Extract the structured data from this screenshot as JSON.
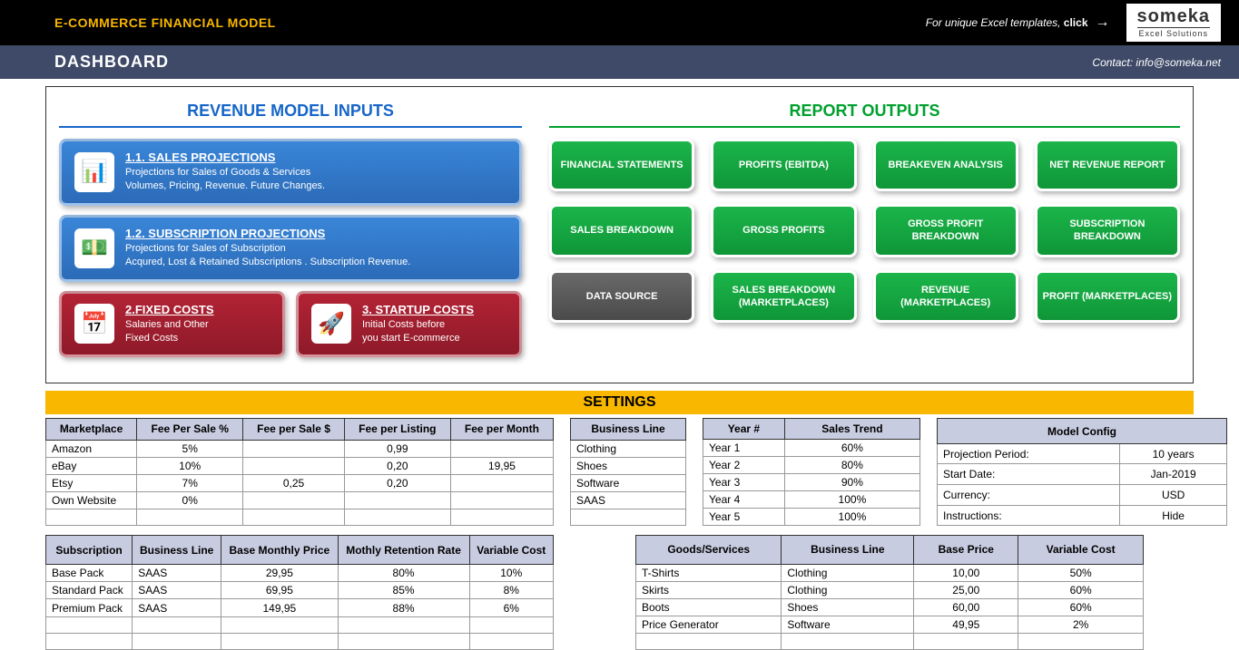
{
  "header": {
    "title": "E-COMMERCE FINANCIAL MODEL",
    "click_text": "For unique Excel templates, ",
    "click_bold": "click",
    "logo_main": "someka",
    "logo_sub": "Excel Solutions",
    "dashboard": "DASHBOARD",
    "contact": "Contact: info@someka.net"
  },
  "sections": {
    "revenue": "REVENUE MODEL INPUTS",
    "reports": "REPORT OUTPUTS",
    "settings": "SETTINGS"
  },
  "cards": {
    "sales": {
      "title": "1.1. SALES PROJECTIONS",
      "line1": "Projections for Sales of Goods & Services",
      "line2": "Volumes, Pricing, Revenue. Future Changes."
    },
    "subs": {
      "title": "1.2. SUBSCRIPTION PROJECTIONS",
      "line1": "Projections for Sales of Subscription",
      "line2": "Acqured, Lost & Retained Subscriptions . Subscription Revenue."
    },
    "fixed": {
      "title": "2.FIXED COSTS",
      "line1": "Salaries and Other",
      "line2": "Fixed Costs"
    },
    "startup": {
      "title": "3. STARTUP COSTS",
      "line1": "Initial Costs before",
      "line2": "you start E-commerce"
    }
  },
  "buttons": [
    "FINANCIAL STATEMENTS",
    "PROFITS (EBITDA)",
    "BREAKEVEN ANALYSIS",
    "NET REVENUE REPORT",
    "SALES BREAKDOWN",
    "GROSS PROFITS",
    "GROSS PROFIT BREAKDOWN",
    "SUBSCRIPTION BREAKDOWN",
    "DATA SOURCE",
    "SALES BREAKDOWN (MARKETPLACES)",
    "REVENUE (MARKETPLACES)",
    "PROFIT (MARKETPLACES)"
  ],
  "marketplace": {
    "headers": [
      "Marketplace",
      "Fee Per Sale %",
      "Fee per Sale $",
      "Fee per Listing",
      "Fee per Month"
    ],
    "rows": [
      [
        "Amazon",
        "5%",
        "",
        "0,99",
        ""
      ],
      [
        "eBay",
        "10%",
        "",
        "0,20",
        "19,95"
      ],
      [
        "Etsy",
        "7%",
        "0,25",
        "0,20",
        ""
      ],
      [
        "Own Website",
        "0%",
        "",
        "",
        ""
      ]
    ]
  },
  "business": {
    "header": "Business Line",
    "rows": [
      "Clothing",
      "Shoes",
      "Software",
      "SAAS"
    ]
  },
  "trend": {
    "headers": [
      "Year #",
      "Sales Trend"
    ],
    "rows": [
      [
        "Year 1",
        "60%"
      ],
      [
        "Year 2",
        "80%"
      ],
      [
        "Year 3",
        "90%"
      ],
      [
        "Year 4",
        "100%"
      ],
      [
        "Year 5",
        "100%"
      ]
    ]
  },
  "config": {
    "header": "Model Config",
    "rows": [
      [
        "Projection Period:",
        "10 years"
      ],
      [
        "Start Date:",
        "Jan-2019"
      ],
      [
        "Currency:",
        "USD"
      ],
      [
        "Instructions:",
        "Hide"
      ]
    ]
  },
  "subscription": {
    "headers": [
      "Subscription",
      "Business Line",
      "Base Monthly Price",
      "Mothly Retention Rate",
      "Variable Cost"
    ],
    "rows": [
      [
        "Base Pack",
        "SAAS",
        "29,95",
        "80%",
        "10%"
      ],
      [
        "Standard Pack",
        "SAAS",
        "69,95",
        "85%",
        "8%"
      ],
      [
        "Premium Pack",
        "SAAS",
        "149,95",
        "88%",
        "6%"
      ]
    ]
  },
  "goods": {
    "headers": [
      "Goods/Services",
      "Business Line",
      "Base Price",
      "Variable Cost"
    ],
    "rows": [
      [
        "T-Shirts",
        "Clothing",
        "10,00",
        "50%"
      ],
      [
        "Skirts",
        "Clothing",
        "25,00",
        "60%"
      ],
      [
        "Boots",
        "Shoes",
        "60,00",
        "60%"
      ],
      [
        "Price Generator",
        "Software",
        "49,95",
        "2%"
      ]
    ]
  }
}
